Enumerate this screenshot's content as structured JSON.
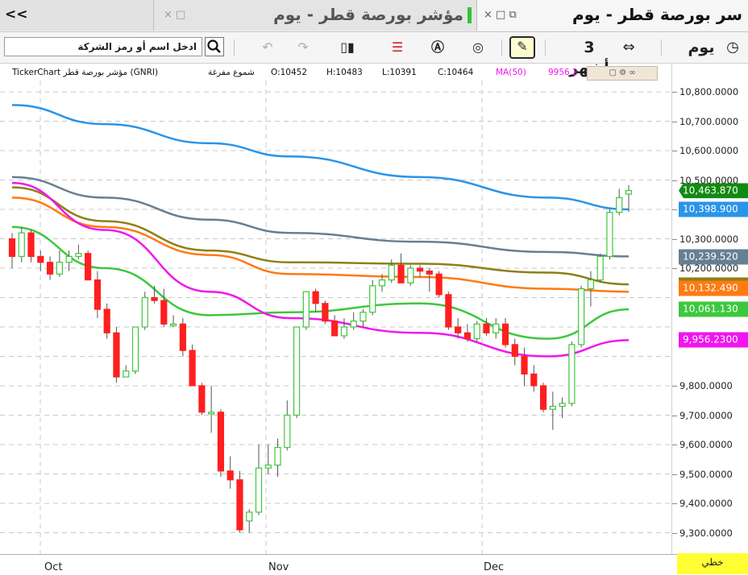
{
  "tabs": {
    "collapse_label": "<<",
    "closed_tab_controls": "× □",
    "tab2_title": "مؤشر بورصة قطر - يوم",
    "tab2_controls": "× □ ⧉",
    "tab1_title": "سر بورصة قطر - يوم"
  },
  "toolbar": {
    "search_value": "ادخل اسم أو رمز الشركة",
    "search_icon": "magnifier-icon",
    "period_label": "3 أشهر",
    "interval_label": "يوم",
    "icons": [
      "undo-icon",
      "redo-icon",
      "candlestick-style-icon",
      "indicator-list-icon",
      "auto-scale-icon",
      "compare-icon",
      "drawing-tool-icon",
      "expand-range-icon",
      "clock-icon"
    ]
  },
  "infobar": {
    "symbol": "TickerChart مؤشر بورصة قطر (GNRI)",
    "chart_style": "شموع مفرغة",
    "open": "O:10452",
    "high": "H:10483",
    "low": "L:10391",
    "close": "C:10464",
    "ma_label": "MA(50)",
    "ma_value": "9956.2"
  },
  "colors": {
    "up": "#3cc83c",
    "down": "#ff1f1f",
    "ma_blue": "#2a94e8",
    "ma_slate": "#667f93",
    "ma_olive": "#8f8012",
    "ma_orange": "#ff7a12",
    "ma_green": "#3cc83c",
    "ma_magenta": "#f015f0",
    "last_price": "#128a12"
  },
  "y_ticks": [
    "10,800.0000",
    "10,700.0000",
    "10,600.0000",
    "10,500.0000",
    "10,400.0000",
    "10,300.0000",
    "10,200.0000",
    "9,800.0000",
    "9,700.0000",
    "9,600.0000",
    "9,500.0000",
    "9,400.0000",
    "9,300.0000"
  ],
  "y_labels": [
    {
      "text": "10,463.870",
      "value": 10463.87,
      "color": "#128a12"
    },
    {
      "text": "10,398.900",
      "value": 10398.9,
      "color": "#2a94e8"
    },
    {
      "text": "10,239.520",
      "value": 10239.52,
      "color": "#667f93"
    },
    {
      "text": "10,143.810",
      "value": 10143.81,
      "color": "#8f8012"
    },
    {
      "text": "10,132.490",
      "value": 10132.49,
      "color": "#ff7a12"
    },
    {
      "text": "10,061.130",
      "value": 10061.13,
      "color": "#3cc83c"
    },
    {
      "text": "9,956.2300",
      "value": 9956.23,
      "color": "#f015f0"
    }
  ],
  "x_ticks": [
    "Oct",
    "Nov",
    "Dec"
  ],
  "chart_style_button": "خطي",
  "chart_data": {
    "type": "candlestick",
    "ylim": [
      9270,
      10860
    ],
    "candles": [
      {
        "o": 10300,
        "h": 10320,
        "l": 10200,
        "c": 10240
      },
      {
        "o": 10240,
        "h": 10340,
        "l": 10220,
        "c": 10320
      },
      {
        "o": 10320,
        "h": 10330,
        "l": 10220,
        "c": 10240
      },
      {
        "o": 10240,
        "h": 10260,
        "l": 10190,
        "c": 10220
      },
      {
        "o": 10220,
        "h": 10240,
        "l": 10160,
        "c": 10180
      },
      {
        "o": 10180,
        "h": 10260,
        "l": 10170,
        "c": 10220
      },
      {
        "o": 10220,
        "h": 10260,
        "l": 10190,
        "c": 10240
      },
      {
        "o": 10240,
        "h": 10280,
        "l": 10230,
        "c": 10250
      },
      {
        "o": 10250,
        "h": 10260,
        "l": 10160,
        "c": 10160
      },
      {
        "o": 10160,
        "h": 10190,
        "l": 10030,
        "c": 10060
      },
      {
        "o": 10060,
        "h": 10080,
        "l": 9960,
        "c": 9980
      },
      {
        "o": 9980,
        "h": 10000,
        "l": 9810,
        "c": 9830
      },
      {
        "o": 9830,
        "h": 9870,
        "l": 9830,
        "c": 9850
      },
      {
        "o": 9850,
        "h": 10000,
        "l": 9840,
        "c": 10000
      },
      {
        "o": 10000,
        "h": 10120,
        "l": 9990,
        "c": 10100
      },
      {
        "o": 10100,
        "h": 10140,
        "l": 10080,
        "c": 10090
      },
      {
        "o": 10090,
        "h": 10130,
        "l": 10000,
        "c": 10010
      },
      {
        "o": 10010,
        "h": 10040,
        "l": 10000,
        "c": 10010
      },
      {
        "o": 10010,
        "h": 10030,
        "l": 9900,
        "c": 9920
      },
      {
        "o": 9920,
        "h": 9940,
        "l": 9800,
        "c": 9800
      },
      {
        "o": 9800,
        "h": 9810,
        "l": 9700,
        "c": 9710
      },
      {
        "o": 9710,
        "h": 9800,
        "l": 9640,
        "c": 9710
      },
      {
        "o": 9710,
        "h": 9720,
        "l": 9490,
        "c": 9510
      },
      {
        "o": 9510,
        "h": 9560,
        "l": 9450,
        "c": 9480
      },
      {
        "o": 9480,
        "h": 9510,
        "l": 9300,
        "c": 9310
      },
      {
        "o": 9340,
        "h": 9380,
        "l": 9300,
        "c": 9370
      },
      {
        "o": 9370,
        "h": 9600,
        "l": 9360,
        "c": 9520
      },
      {
        "o": 9520,
        "h": 9600,
        "l": 9500,
        "c": 9530
      },
      {
        "o": 9530,
        "h": 9620,
        "l": 9490,
        "c": 9590
      },
      {
        "o": 9590,
        "h": 9750,
        "l": 9580,
        "c": 9700
      },
      {
        "o": 9700,
        "h": 10000,
        "l": 9690,
        "c": 10000
      },
      {
        "o": 10000,
        "h": 10120,
        "l": 9990,
        "c": 10120
      },
      {
        "o": 10120,
        "h": 10130,
        "l": 10050,
        "c": 10080
      },
      {
        "o": 10080,
        "h": 10090,
        "l": 10010,
        "c": 10020
      },
      {
        "o": 10020,
        "h": 10040,
        "l": 9990,
        "c": 9970
      },
      {
        "o": 9970,
        "h": 10030,
        "l": 9960,
        "c": 10000
      },
      {
        "o": 10000,
        "h": 10050,
        "l": 9990,
        "c": 10020
      },
      {
        "o": 10020,
        "h": 10060,
        "l": 10000,
        "c": 10050
      },
      {
        "o": 10050,
        "h": 10160,
        "l": 10040,
        "c": 10140
      },
      {
        "o": 10140,
        "h": 10180,
        "l": 10120,
        "c": 10160
      },
      {
        "o": 10160,
        "h": 10230,
        "l": 10150,
        "c": 10210
      },
      {
        "o": 10210,
        "h": 10250,
        "l": 10160,
        "c": 10150
      },
      {
        "o": 10150,
        "h": 10210,
        "l": 10140,
        "c": 10200
      },
      {
        "o": 10200,
        "h": 10210,
        "l": 10170,
        "c": 10190
      },
      {
        "o": 10190,
        "h": 10200,
        "l": 10120,
        "c": 10180
      },
      {
        "o": 10180,
        "h": 10190,
        "l": 10100,
        "c": 10110
      },
      {
        "o": 10110,
        "h": 10120,
        "l": 9990,
        "c": 10000
      },
      {
        "o": 10000,
        "h": 10030,
        "l": 9960,
        "c": 9980
      },
      {
        "o": 9980,
        "h": 10010,
        "l": 9950,
        "c": 9960
      },
      {
        "o": 9960,
        "h": 10020,
        "l": 9950,
        "c": 10010
      },
      {
        "o": 10010,
        "h": 10030,
        "l": 9970,
        "c": 9980
      },
      {
        "o": 9980,
        "h": 10030,
        "l": 9960,
        "c": 10010
      },
      {
        "o": 10010,
        "h": 10030,
        "l": 9930,
        "c": 9940
      },
      {
        "o": 9940,
        "h": 9960,
        "l": 9870,
        "c": 9900
      },
      {
        "o": 9900,
        "h": 9930,
        "l": 9800,
        "c": 9840
      },
      {
        "o": 9840,
        "h": 9870,
        "l": 9780,
        "c": 9800
      },
      {
        "o": 9800,
        "h": 9810,
        "l": 9710,
        "c": 9720
      },
      {
        "o": 9720,
        "h": 9780,
        "l": 9650,
        "c": 9730
      },
      {
        "o": 9730,
        "h": 9760,
        "l": 9690,
        "c": 9740
      },
      {
        "o": 9740,
        "h": 9950,
        "l": 9730,
        "c": 9940
      },
      {
        "o": 9940,
        "h": 10140,
        "l": 9930,
        "c": 10130
      },
      {
        "o": 10130,
        "h": 10190,
        "l": 10070,
        "c": 10160
      },
      {
        "o": 10160,
        "h": 10250,
        "l": 10150,
        "c": 10240
      },
      {
        "o": 10240,
        "h": 10400,
        "l": 10230,
        "c": 10390
      },
      {
        "o": 10390,
        "h": 10470,
        "l": 10380,
        "c": 10440
      },
      {
        "o": 10452,
        "h": 10483,
        "l": 10391,
        "c": 10464
      }
    ],
    "moving_averages": [
      {
        "color": "#2a94e8",
        "values": [
          10755,
          10690,
          10625,
          10580,
          10510,
          10440,
          10400
        ]
      },
      {
        "color": "#667f93",
        "values": [
          10510,
          10440,
          10365,
          10320,
          10290,
          10255,
          10240
        ]
      },
      {
        "color": "#8f8012",
        "values": [
          10475,
          10360,
          10260,
          10220,
          10215,
          10185,
          10145
        ]
      },
      {
        "color": "#ff7a12",
        "values": [
          10440,
          10340,
          10245,
          10180,
          10170,
          10130,
          10120
        ]
      },
      {
        "color": "#3cc83c",
        "values": [
          10340,
          10200,
          10040,
          10050,
          10080,
          9960,
          10060
        ]
      },
      {
        "color": "#f015f0",
        "values": [
          10490,
          10330,
          10120,
          10030,
          9980,
          9900,
          9955
        ]
      }
    ],
    "x_labels": [
      "Oct",
      "Nov",
      "Dec"
    ]
  }
}
